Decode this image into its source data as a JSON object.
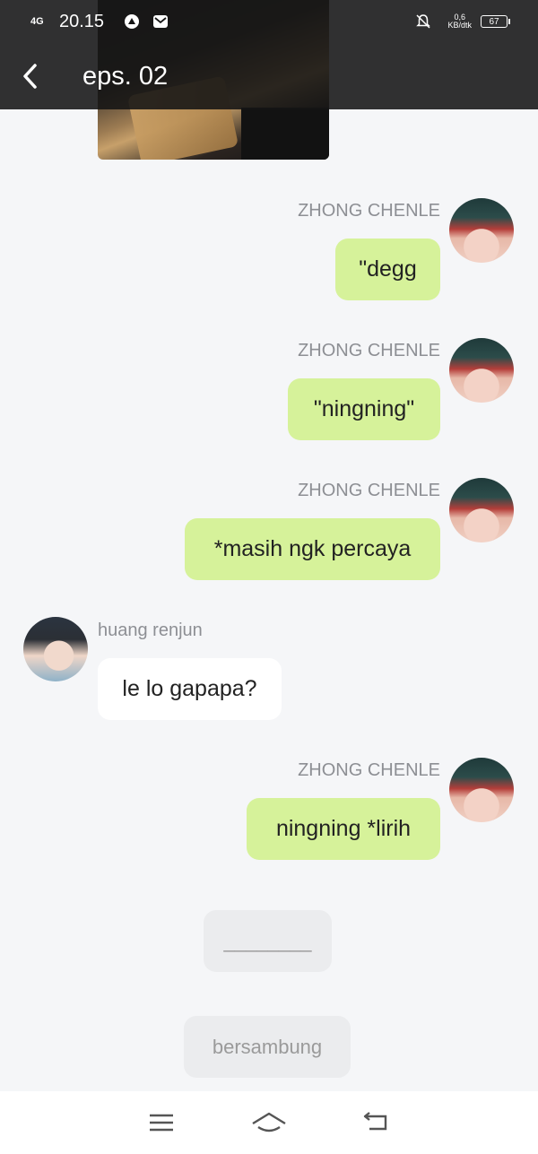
{
  "status_bar": {
    "network": "4G",
    "time": "20.15",
    "speed_value": "0,6",
    "speed_unit": "KB/dtk",
    "battery": "67"
  },
  "header": {
    "title": "eps. 02",
    "back_icon": "chevron-left-icon"
  },
  "messages": [
    {
      "sender": "ZHONG CHENLE",
      "text": "\"degg",
      "side": "right"
    },
    {
      "sender": "ZHONG CHENLE",
      "text": "\"ningning\"",
      "side": "right"
    },
    {
      "sender": "ZHONG CHENLE",
      "text": "*masih ngk percaya",
      "side": "right"
    },
    {
      "sender": "huang renjun",
      "text": "le lo gapapa?",
      "side": "left"
    },
    {
      "sender": "ZHONG CHENLE",
      "text": "ningning *lirih",
      "side": "right"
    }
  ],
  "divider_text": "________",
  "continue_label": "bersambung",
  "colors": {
    "bubble_green": "#d6f29a",
    "bubble_white": "#ffffff",
    "background": "#f5f6f8",
    "header": "#141414"
  }
}
